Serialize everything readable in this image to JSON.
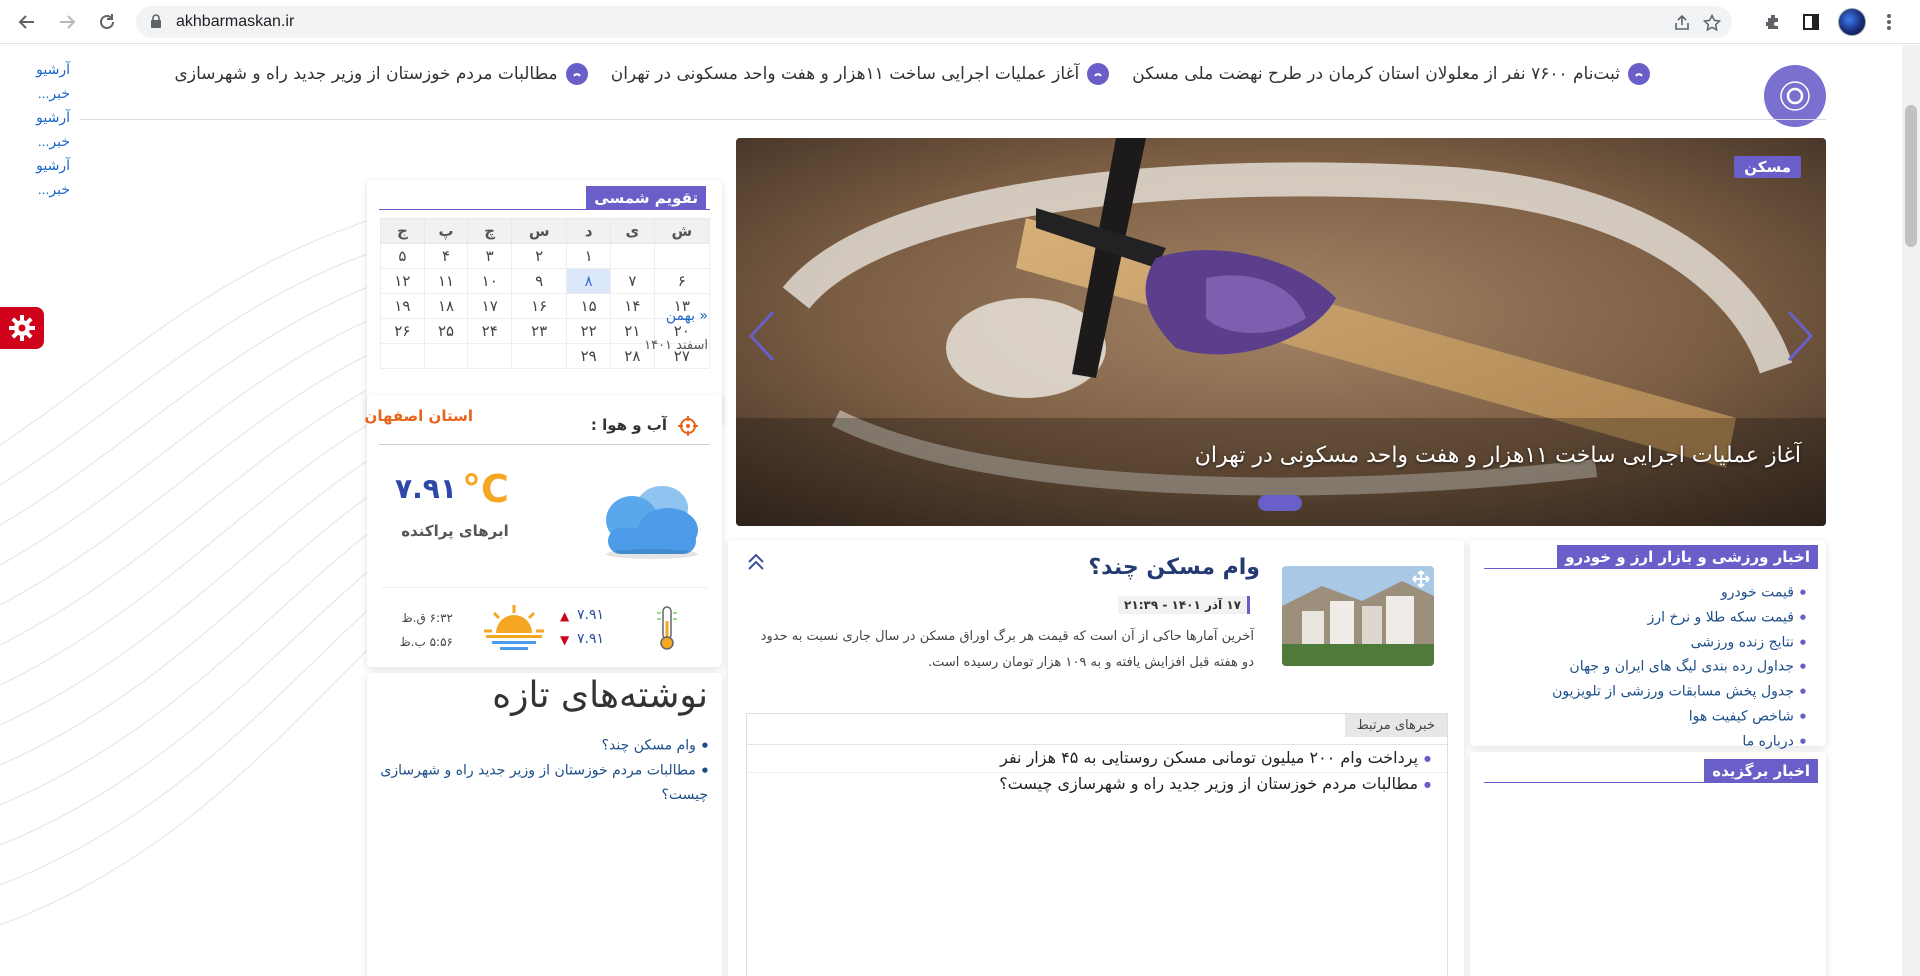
{
  "browser": {
    "url": "akhbarmaskan.ir"
  },
  "archive_links": [
    "آرشیو",
    "خبر...",
    "آرشیو",
    "خبر...",
    "آرشیو",
    "خبر..."
  ],
  "ticker": {
    "items": [
      "ثبت‌نام ۷۶۰۰ نفر از معلولان استان کرمان در طرح نهضت ملی مسکن",
      "آغاز عملیات اجرایی ساخت ۱۱هزار و هفت واحد مسکونی در تهران",
      "مطالبات مردم خوزستان از وزیر جدید راه و شهرسازی"
    ]
  },
  "calendar": {
    "title": "تقویم شمسی",
    "weekdays": [
      "ش",
      "ی",
      "د",
      "س",
      "چ",
      "پ",
      "ج"
    ],
    "rows": [
      [
        "",
        "",
        "۱",
        "۲",
        "۳",
        "۴",
        "۵"
      ],
      [
        "۶",
        "۷",
        "۸",
        "۹",
        "۱۰",
        "۱۱",
        "۱۲"
      ],
      [
        "۱۳",
        "۱۴",
        "۱۵",
        "۱۶",
        "۱۷",
        "۱۸",
        "۱۹"
      ],
      [
        "۲۰",
        "۲۱",
        "۲۲",
        "۲۳",
        "۲۴",
        "۲۵",
        "۲۶"
      ],
      [
        "۲۷",
        "۲۸",
        "۲۹",
        "",
        "",
        "",
        ""
      ]
    ],
    "today": "۸",
    "prev_month_link": "« بهمن",
    "current_month": "اسفند ۱۴۰۱"
  },
  "slider": {
    "tag": "مسکن",
    "caption": "آغاز عملیات اجرایی ساخت ۱۱هزار و هفت واحد مسکونی در تهران"
  },
  "weather": {
    "title": "آب و هوا :",
    "province": "استان اصفهان",
    "unit": "°C",
    "temperature": "۷.۹۱",
    "condition": "ابرهای پراکنده",
    "max_temp": "۷.۹۱",
    "min_temp": "۷.۹۱",
    "sunrise": "۶:۳۲ ق.ظ",
    "sunset": "۵:۵۶ ب.ظ"
  },
  "main_news": {
    "headline": "وام مسکن چند؟",
    "date": "۱۷ آذر ۱۴۰۱ - ۲۱:۳۹",
    "summary": "آخرین آمارها حاکی از آن است که قیمت هر برگ اوراق مسکن در سال جاری نسبت به حدود دو هفته قبل افزایش یافته و به ۱۰۹ هزار تومان رسیده است.",
    "related_tab": "خبرهای مرتبط",
    "related": [
      "پرداخت وام ۲۰۰ میلیون تومانی مسکن روستایی به ۴۵ هزار نفر",
      "مطالبات مردم خوزستان از وزیر جدید راه و شهرسازی چیست؟"
    ]
  },
  "sports_box": {
    "title": "اخبار ورزشی و بازار ارز و خودرو",
    "links": [
      "قیمت خودرو",
      "قیمت سکه طلا و نرخ ارز",
      "نتایج زنده ورزشی",
      "جداول رده بندی لیگ های ایران و جهان",
      "جدول پخش مسابقات ورزشی از تلویزیون",
      "شاخص کیفیت هوا",
      "درباره ما"
    ]
  },
  "featured_box": {
    "title": "اخبار برگزیده"
  },
  "recent_posts": {
    "title": "نوشته‌های تازه",
    "items": [
      "وام مسکن چند؟",
      "مطالبات مردم خوزستان از وزیر جدید راه و شهرسازی چیست؟"
    ]
  },
  "colors": {
    "accent": "#6a5fc8",
    "province": "#e8641b",
    "temperature": "#2d48a8",
    "unit": "#f5a623",
    "gear": "#d0021b"
  }
}
